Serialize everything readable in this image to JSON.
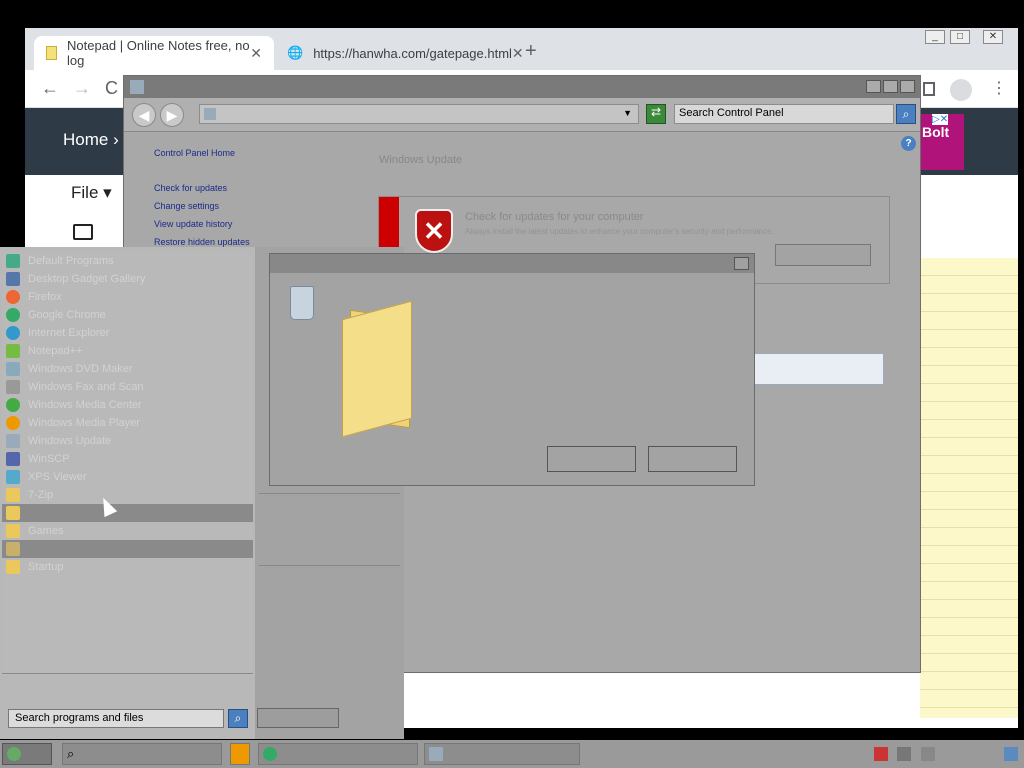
{
  "browser": {
    "tabs": [
      {
        "label": "Notepad | Online Notes free, no log"
      },
      {
        "label": "https://hanwha.com/gatepage.html"
      }
    ],
    "new_tab": "+",
    "nav": {
      "back": "←",
      "forward": "→",
      "reload": "C"
    },
    "site": {
      "home_link": "Home ›",
      "file_menu": "File ▾",
      "ad_text": "Bolt",
      "ad_badges": "▷✕"
    }
  },
  "control_panel": {
    "search_placeholder": "Search Control Panel",
    "sidebar_links": [
      "Control Panel Home",
      "Check for updates",
      "Change settings",
      "View update history",
      "Restore hidden updates"
    ],
    "section_title": "Windows Update",
    "status_heading": "Check for updates for your computer",
    "status_sub": "Always install the latest updates to enhance your computer's security and performance.",
    "help": "?"
  },
  "start_menu": {
    "programs": [
      "Default Programs",
      "Desktop Gadget Gallery",
      "Firefox",
      "Google Chrome",
      "Internet Explorer",
      "Notepad++",
      "Windows DVD Maker",
      "Windows Fax and Scan",
      "Windows Media Center",
      "Windows Media Player",
      "Windows Update",
      "WinSCP",
      "XPS Viewer",
      "7-Zip",
      "",
      "Games",
      "",
      "Startup"
    ],
    "search_placeholder": "Search programs and files"
  },
  "colors": {
    "ad": "#b0137a",
    "chrome_header": "#2e3a46",
    "notes": "#fdf8c9"
  }
}
